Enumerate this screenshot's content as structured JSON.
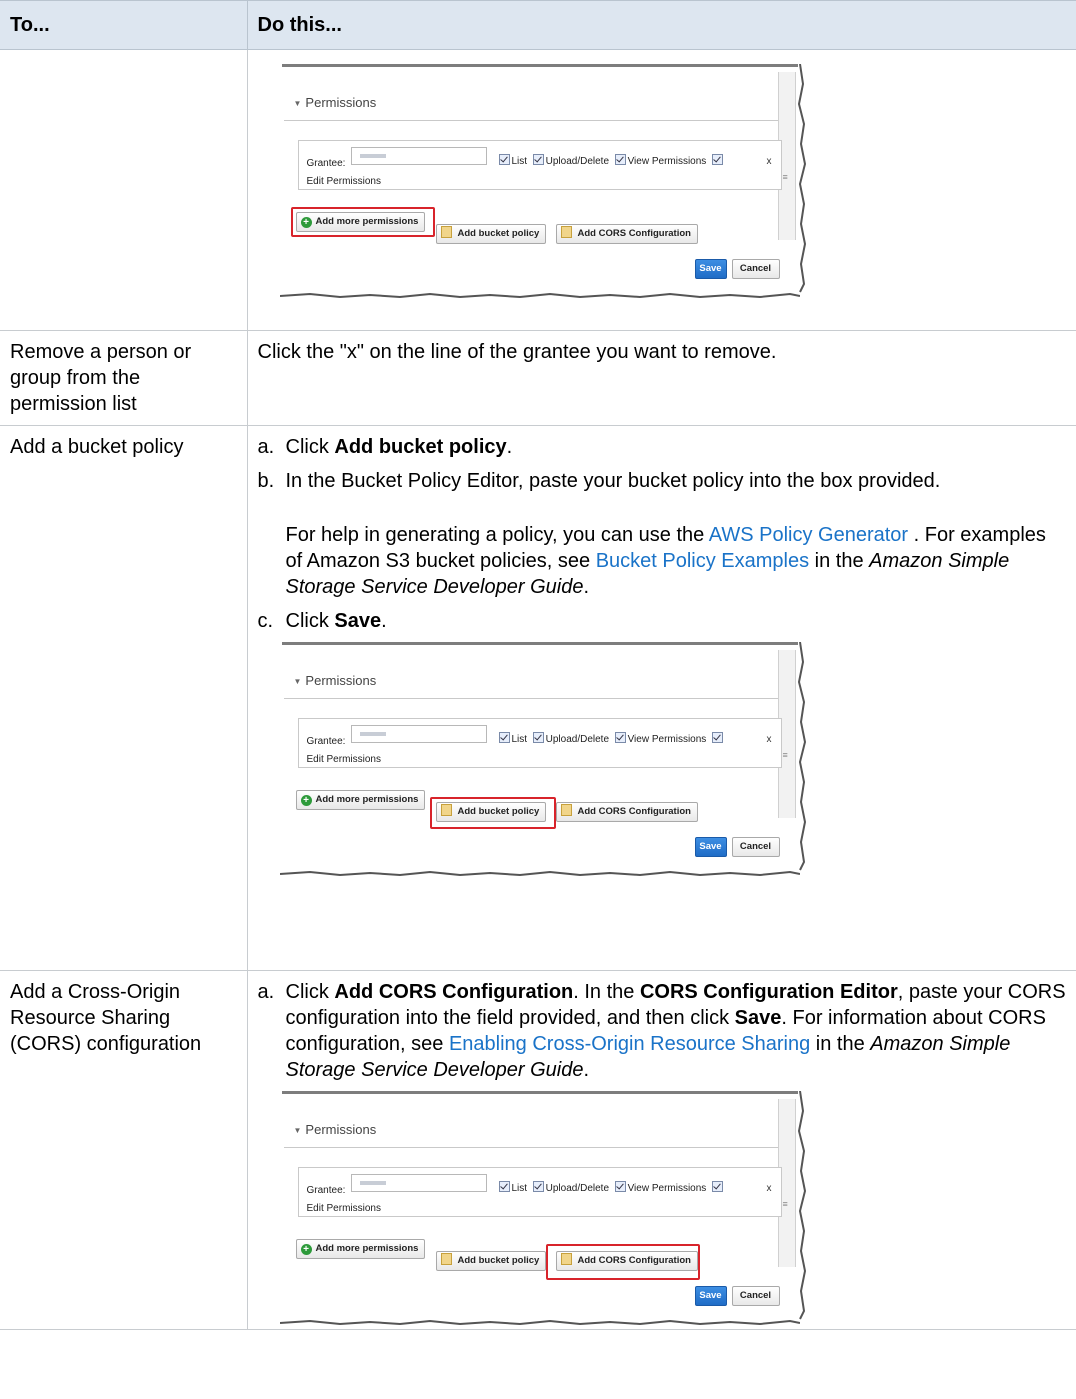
{
  "header": {
    "col_to": "To...",
    "col_do": "Do this..."
  },
  "screenshot": {
    "section": "Permissions",
    "grantee_label": "Grantee:",
    "check_list": "List",
    "check_upload": "Upload/Delete",
    "check_view": "View Permissions",
    "close_x": "x",
    "edit_permissions": "Edit Permissions",
    "add_more": "Add more permissions",
    "add_policy": "Add bucket policy",
    "add_cors": "Add CORS Configuration",
    "save": "Save",
    "cancel": "Cancel",
    "highlight_color": "#d8242b"
  },
  "rows": {
    "remove": {
      "to": "Remove a person or group from the permission list",
      "do": "Click the \"x\" on the line of the grantee you want to remove."
    },
    "policy": {
      "to": "Add a bucket policy",
      "a_mark": "a.",
      "a_pre": "Click ",
      "a_bold": "Add bucket policy",
      "a_post": ".",
      "b_mark": "b.",
      "b_text": "In the Bucket Policy Editor, paste your bucket policy into the box provided.",
      "p1_pre": "For help in generating a policy, you can use the ",
      "p1_link": "AWS Policy Generator",
      "p1_mid": " . For examples of Amazon S3 bucket policies, see ",
      "p1_link2": "Bucket Policy Examples",
      "p1_mid2": " in the ",
      "p1_italic": "Amazon Simple Storage Service Developer Guide",
      "p1_end": ".",
      "c_mark": "c.",
      "c_pre": "Click ",
      "c_bold": "Save",
      "c_post": "."
    },
    "cors": {
      "to": "Add a Cross-Origin Resource Sharing (CORS) configuration",
      "a_mark": "a.",
      "a_pre": "Click ",
      "a_bold1": "Add CORS Configuration",
      "a_mid1": ". In the ",
      "a_bold2": "CORS Configuration Editor",
      "a_mid2": ", paste your CORS configuration into the field provided, and then click ",
      "a_bold3": "Save",
      "a_mid3": ". For information about CORS configuration, see ",
      "a_link": "Enabling Cross-Origin Resource Sharing",
      "a_mid4": " in the ",
      "a_italic": "Amazon Simple Storage Service Developer Guide",
      "a_end": "."
    }
  }
}
